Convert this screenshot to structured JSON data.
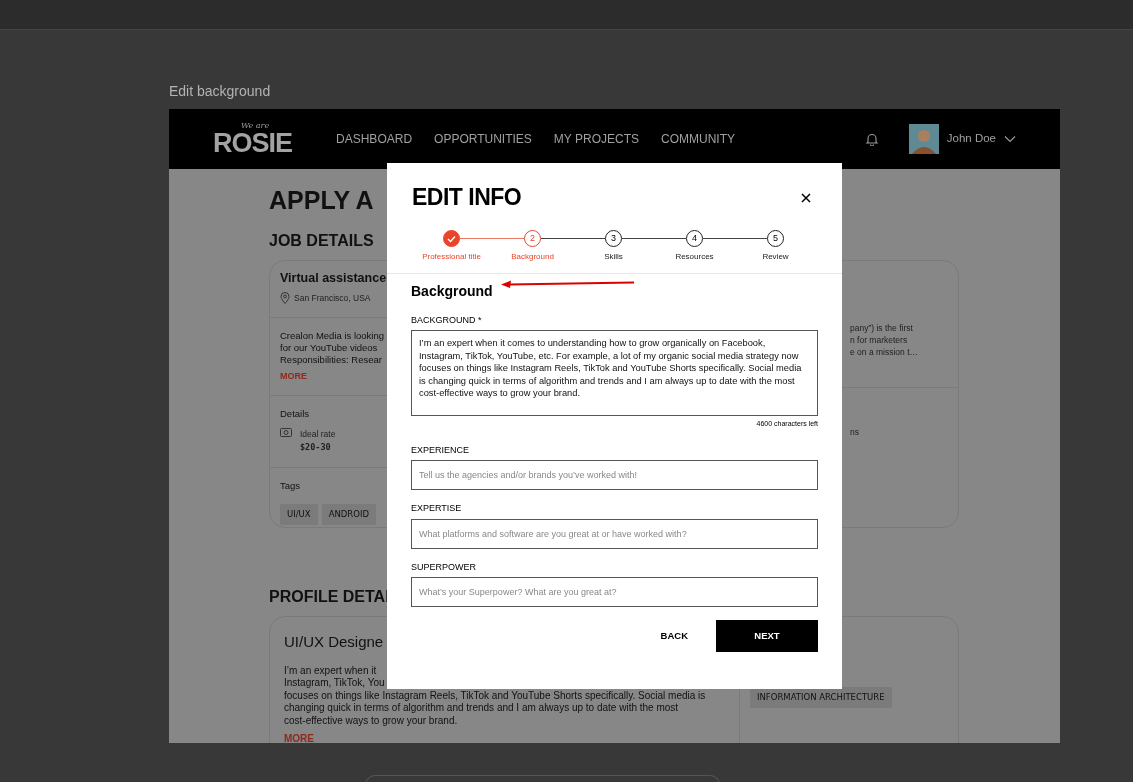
{
  "canvas": {
    "frame_label": "Edit background"
  },
  "navbar": {
    "logo_tagline": "We are",
    "logo": "ROSIE",
    "links": [
      "DASHBOARD",
      "OPPORTUNITIES",
      "MY PROJECTS",
      "COMMUNITY"
    ],
    "user": "John Doe"
  },
  "page": {
    "title": "APPLY A",
    "job_section": "JOB DETAILS",
    "job_card": {
      "title": "Virtual assistance",
      "location": "San Francisco, USA",
      "description_lines": [
        "Crealon Media is looking",
        "for our YouTube videos",
        "Responsibilities: Resear"
      ],
      "more": "MORE",
      "details_heading": "Details",
      "rate_label": "Ideal rate",
      "rate": "$20-30",
      "tags_heading": "Tags",
      "tags": [
        "UI/UX",
        "ANDROID"
      ],
      "right_lines": [
        "pany”) is the first",
        "n for marketers",
        "e on a mission t…"
      ],
      "right_detail": "ns"
    },
    "profile_section": "PROFILE DETAI",
    "profile_card": {
      "title": "UI/UX Designe",
      "top_lines": [
        "I’m an expert when it",
        "Instagram, TikTok, You"
      ],
      "lines": [
        "focuses on things like Instagram Reels, TikTok and YouTube Shorts specifically. Social media is",
        "changing quick in terms of algorithm and trends and I am always up to date with the most",
        "cost-effective ways to grow your brand."
      ],
      "more": "MORE",
      "tags": [
        "INFORMATION ARCHITECTURE"
      ]
    }
  },
  "modal": {
    "title": "EDIT INFO",
    "steps": [
      {
        "label": "Professional title",
        "completed": true,
        "selected": false
      },
      {
        "number": "2",
        "label": "Background",
        "completed": false,
        "selected": true
      },
      {
        "number": "3",
        "label": "Skills",
        "completed": false,
        "selected": false
      },
      {
        "number": "4",
        "label": "Resources",
        "completed": false,
        "selected": false
      },
      {
        "number": "5",
        "label": "Review",
        "completed": false,
        "selected": false
      }
    ],
    "section_title": "Background",
    "fields": [
      {
        "kind": "textarea",
        "label": "BACKGROUND *",
        "value": "I’m an expert when it comes to understanding how to grow organically on Facebook, Instagram, TikTok, YouTube, etc. For example, a lot of my organic social media strategy now focuses on things like Instagram Reels, TikTok and YouTube Shorts specifically. Social media is changing quick in terms of algorithm and trends and I am always up to date with the most cost-effective ways to grow your brand.",
        "counter": "4600 characters left"
      },
      {
        "kind": "input",
        "label": "EXPERIENCE",
        "placeholder": "Tell us the agencies and/or brands you’ve worked with!"
      },
      {
        "kind": "input",
        "label": "EXPERTISE",
        "placeholder": "What platforms and software are you great at or have worked with?"
      },
      {
        "kind": "input",
        "label": "SUPERPOWER",
        "placeholder": "What’s your Superpower? What are you great at?"
      }
    ],
    "back": "BACK",
    "next": "NEXT"
  }
}
